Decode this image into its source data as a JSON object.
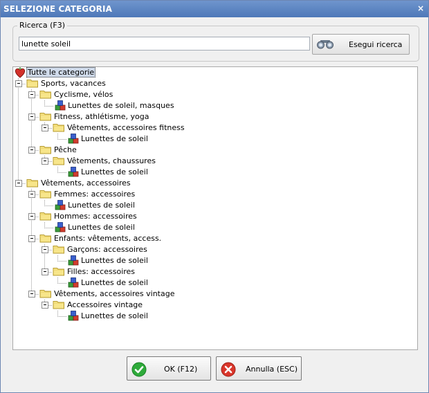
{
  "window": {
    "title": "SELEZIONE CATEGORIA",
    "close_glyph": "×"
  },
  "search": {
    "group_label": "Ricerca (F3)",
    "value": "lunette soleil",
    "button_label": "Esegui ricerca",
    "button_icon": "binoculars-icon"
  },
  "tree": {
    "root_label": "Tutte le categorie",
    "nodes": [
      "Sports, vacances",
      "Cyclisme, vélos",
      "Lunettes de soleil, masques",
      "Fitness, athlétisme, yoga",
      "Vêtements, accessoires fitness",
      "Lunettes de soleil",
      "Pêche",
      "Vêtements, chaussures",
      "Lunettes de soleil",
      "Vêtements, accessoires",
      "Femmes: accessoires",
      "Lunettes de soleil",
      "Hommes: accessoires",
      "Lunettes de soleil",
      "Enfants: vêtements, access.",
      "Garçons: accessoires",
      "Lunettes de soleil",
      "Filles: accessoires",
      "Lunettes de soleil",
      "Vêtements, accessoires vintage",
      "Accessoires vintage",
      "Lunettes de soleil"
    ]
  },
  "footer": {
    "ok_label": "OK (F12)",
    "cancel_label": "Annulla (ESC)"
  },
  "colors": {
    "titlebar": "#5a82c1",
    "selection": "#cfdaea",
    "folder": "#f7e58a",
    "ok_green": "#2eaa3a",
    "cancel_red": "#d9362b"
  }
}
